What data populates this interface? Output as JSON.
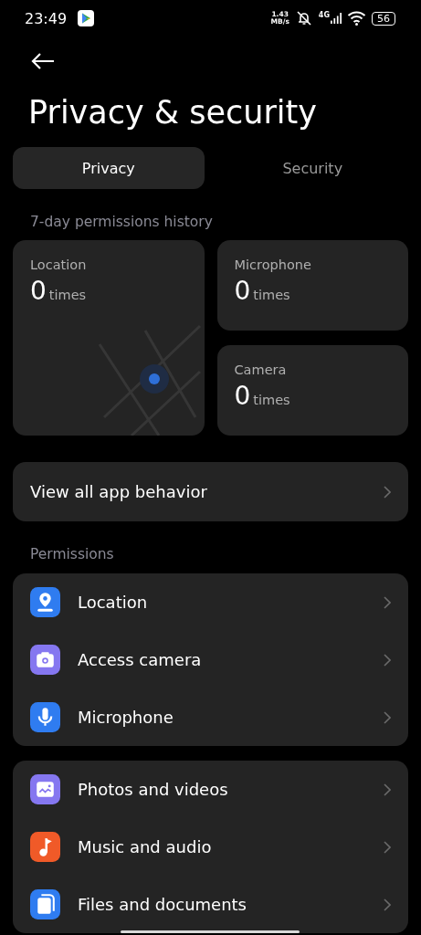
{
  "status_bar": {
    "time": "23:49",
    "speed": "1.43",
    "speed_unit": "MB/s",
    "network": "4G",
    "battery": "56"
  },
  "title": "Privacy & security",
  "tabs": [
    {
      "label": "Privacy",
      "selected": true
    },
    {
      "label": "Security",
      "selected": false
    }
  ],
  "history": {
    "heading": "7-day permissions history",
    "cards": [
      {
        "kind": "map",
        "label": "Location",
        "count": "0",
        "unit": "times"
      },
      {
        "kind": "plain",
        "label": "Microphone",
        "count": "0",
        "unit": "times"
      },
      {
        "kind": "plain",
        "label": "Camera",
        "count": "0",
        "unit": "times"
      }
    ]
  },
  "view_all": "View all app behavior",
  "permissions_heading": "Permissions",
  "groups": [
    [
      {
        "kind": "location",
        "label": "Location",
        "color": "#2f7cf0"
      },
      {
        "kind": "camera",
        "label": "Access camera",
        "color": "#8577f0"
      },
      {
        "kind": "microphone",
        "label": "Microphone",
        "color": "#2f7cf0"
      }
    ],
    [
      {
        "kind": "photos",
        "label": "Photos and videos",
        "color": "#8577f0"
      },
      {
        "kind": "music",
        "label": "Music and audio",
        "color": "#f05a28"
      },
      {
        "kind": "files",
        "label": "Files and documents",
        "color": "#2f7cf0"
      }
    ]
  ]
}
